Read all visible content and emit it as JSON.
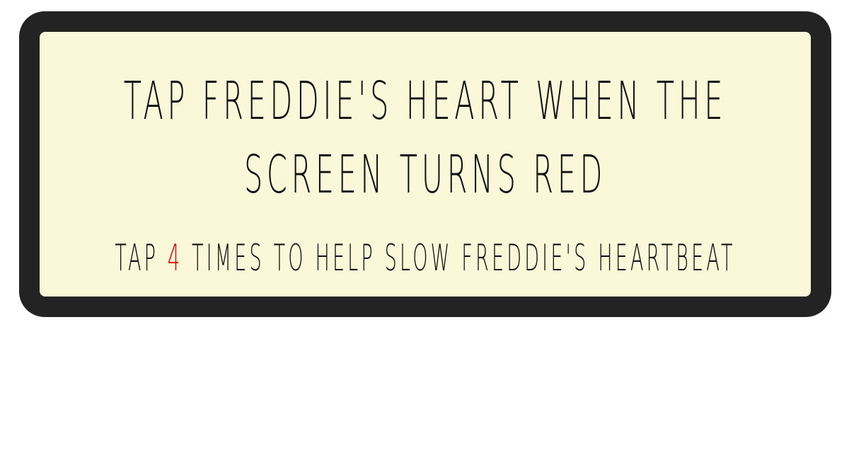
{
  "instructions": {
    "title": "Tap Freddie's heart when the screen turns red",
    "subtitle_prefix": "Tap ",
    "tap_count": "4",
    "subtitle_suffix": " times to help slow Freddie's heartbeat"
  },
  "colors": {
    "frame": "#232323",
    "panel": "#fbf7d9",
    "text": "#111111",
    "highlight": "#e00000"
  }
}
